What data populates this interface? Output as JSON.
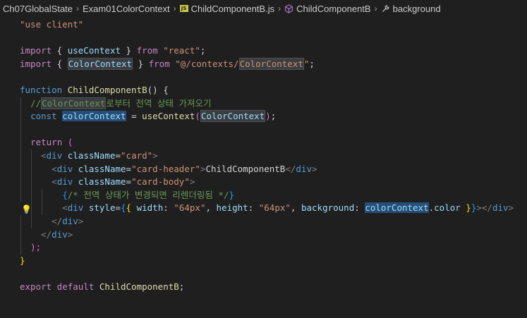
{
  "breadcrumb": {
    "items": [
      "Ch07GlobalState",
      "Exam01ColorContext",
      "ChildComponentB.js",
      "ChildComponentB",
      "background"
    ],
    "file_icon_text": "JS"
  },
  "code": {
    "l1": "\"use client\"",
    "l3_kw": "import",
    "l3_b1": " { ",
    "l3_name": "useContext",
    "l3_b2": " } ",
    "l3_from": "from",
    "l3_str": " \"react\"",
    "l3_end": ";",
    "l4_kw": "import",
    "l4_b1": " { ",
    "l4_name": "ColorContext",
    "l4_b2": " } ",
    "l4_from": "from",
    "l4_str_a": " \"@/contexts/",
    "l4_str_b": "ColorContext",
    "l4_str_c": "\"",
    "l4_end": ";",
    "l6_kw": "function",
    "l6_fn": " ChildComponentB",
    "l6_rest": "() {",
    "l7_a": "//",
    "l7_b": "ColorContext",
    "l7_c": "로부터 전역 상태 가져오기",
    "l8_kw": "const",
    "l8_sp": " ",
    "l8_var": "colorContext",
    "l8_eq": " = ",
    "l8_fn": "useContext",
    "l8_p1": "(",
    "l8_arg": "ColorContext",
    "l8_p2": ")",
    "l8_end": ";",
    "l10_kw": "return",
    "l10_p": " (",
    "l11_o": "<",
    "l11_t": "div",
    "l11_a": " className",
    "l11_eq": "=",
    "l11_s": "\"card\"",
    "l11_c": ">",
    "l12_o": "<",
    "l12_t": "div",
    "l12_a": " className",
    "l12_eq": "=",
    "l12_s": "\"card-header\"",
    "l12_c": ">",
    "l12_txt": "ChildComponentB",
    "l12_co": "</",
    "l12_ct": "div",
    "l12_cc": ">",
    "l13_o": "<",
    "l13_t": "div",
    "l13_a": " className",
    "l13_eq": "=",
    "l13_s": "\"card-body\"",
    "l13_c": ">",
    "l14_b": "{",
    "l14_c": "/* 전역 상태가 변경되면 리렌더링됨 */",
    "l14_e": "}",
    "l15_o": "<",
    "l15_t": "div",
    "l15_a": " style",
    "l15_eq": "=",
    "l15_b1": "{",
    "l15_b2": "{ ",
    "l15_k1": "width",
    "l15_c1": ": ",
    "l15_s1": "\"64px\"",
    "l15_cm1": ", ",
    "l15_k2": "height",
    "l15_c2": ": ",
    "l15_s2": "\"64px\"",
    "l15_cm2": ", ",
    "l15_k3": "background",
    "l15_c3": ": ",
    "l15_v": "colorContext",
    "l15_dot": ".",
    "l15_prop": "color",
    "l15_b3": " }",
    "l15_b4": "}",
    "l15_cl": "></",
    "l15_ct": "div",
    "l15_cc": ">",
    "l16_o": "</",
    "l16_t": "div",
    "l16_c": ">",
    "l17_o": "</",
    "l17_t": "div",
    "l17_c": ">",
    "l18": ");",
    "l19": "}",
    "l21_kw1": "export",
    "l21_kw2": " default",
    "l21_fn": " ChildComponentB",
    "l21_end": ";"
  },
  "icons": {
    "folder_sep": "chevron-right-icon",
    "file": "js-file-icon",
    "component": "cube-icon",
    "property": "wrench-icon",
    "lightbulb": "lightbulb-icon"
  }
}
